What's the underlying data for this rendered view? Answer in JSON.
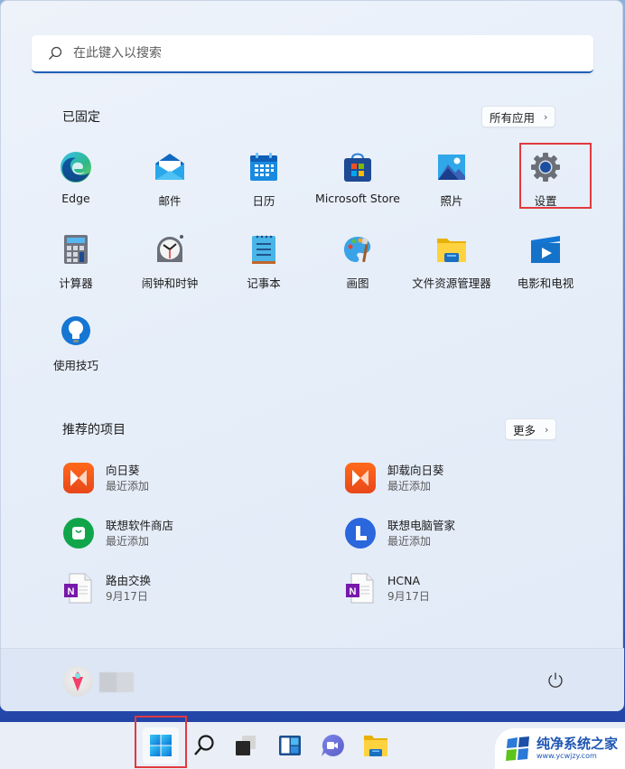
{
  "search": {
    "placeholder": "在此键入以搜索",
    "icon": "search-icon"
  },
  "pinned": {
    "title": "已固定",
    "all_apps_label": "所有应用",
    "apps": [
      {
        "label": "Edge",
        "icon": "edge-icon"
      },
      {
        "label": "邮件",
        "icon": "mail-icon"
      },
      {
        "label": "日历",
        "icon": "calendar-icon"
      },
      {
        "label": "Microsoft Store",
        "icon": "store-icon"
      },
      {
        "label": "照片",
        "icon": "photos-icon"
      },
      {
        "label": "设置",
        "icon": "settings-gear-icon",
        "highlighted": true
      },
      {
        "label": "计算器",
        "icon": "calculator-icon"
      },
      {
        "label": "闹钟和时钟",
        "icon": "alarm-clock-icon"
      },
      {
        "label": "记事本",
        "icon": "notepad-icon"
      },
      {
        "label": "画图",
        "icon": "paint-palette-icon"
      },
      {
        "label": "文件资源管理器",
        "icon": "folder-icon"
      },
      {
        "label": "电影和电视",
        "icon": "movies-tv-icon"
      },
      {
        "label": "使用技巧",
        "icon": "tips-lightbulb-icon"
      }
    ]
  },
  "recommended": {
    "title": "推荐的项目",
    "more_label": "更多",
    "items": [
      {
        "name": "向日葵",
        "sub": "最近添加",
        "icon": "sunflower-icon"
      },
      {
        "name": "卸载向日葵",
        "sub": "最近添加",
        "icon": "sunflower-icon"
      },
      {
        "name": "联想软件商店",
        "sub": "最近添加",
        "icon": "lenovo-store-icon"
      },
      {
        "name": "联想电脑管家",
        "sub": "最近添加",
        "icon": "lenovo-pc-manager-icon"
      },
      {
        "name": "路由交换",
        "sub": "9月17日",
        "icon": "onenote-file-icon"
      },
      {
        "name": "HCNA",
        "sub": "9月17日",
        "icon": "onenote-file-icon"
      }
    ]
  },
  "footer": {
    "user_icon": "avatar",
    "power_icon": "power-icon"
  },
  "taskbar": {
    "items": [
      "start-icon",
      "search-icon",
      "task-view-icon",
      "widgets-icon",
      "teams-chat-icon",
      "file-explorer-icon"
    ]
  },
  "watermark": {
    "title": "纯净系统之家",
    "url": "www.ycwjzy.com"
  },
  "colors": {
    "accent": "#1f5fb8",
    "highlight_box": "#e2393f"
  }
}
